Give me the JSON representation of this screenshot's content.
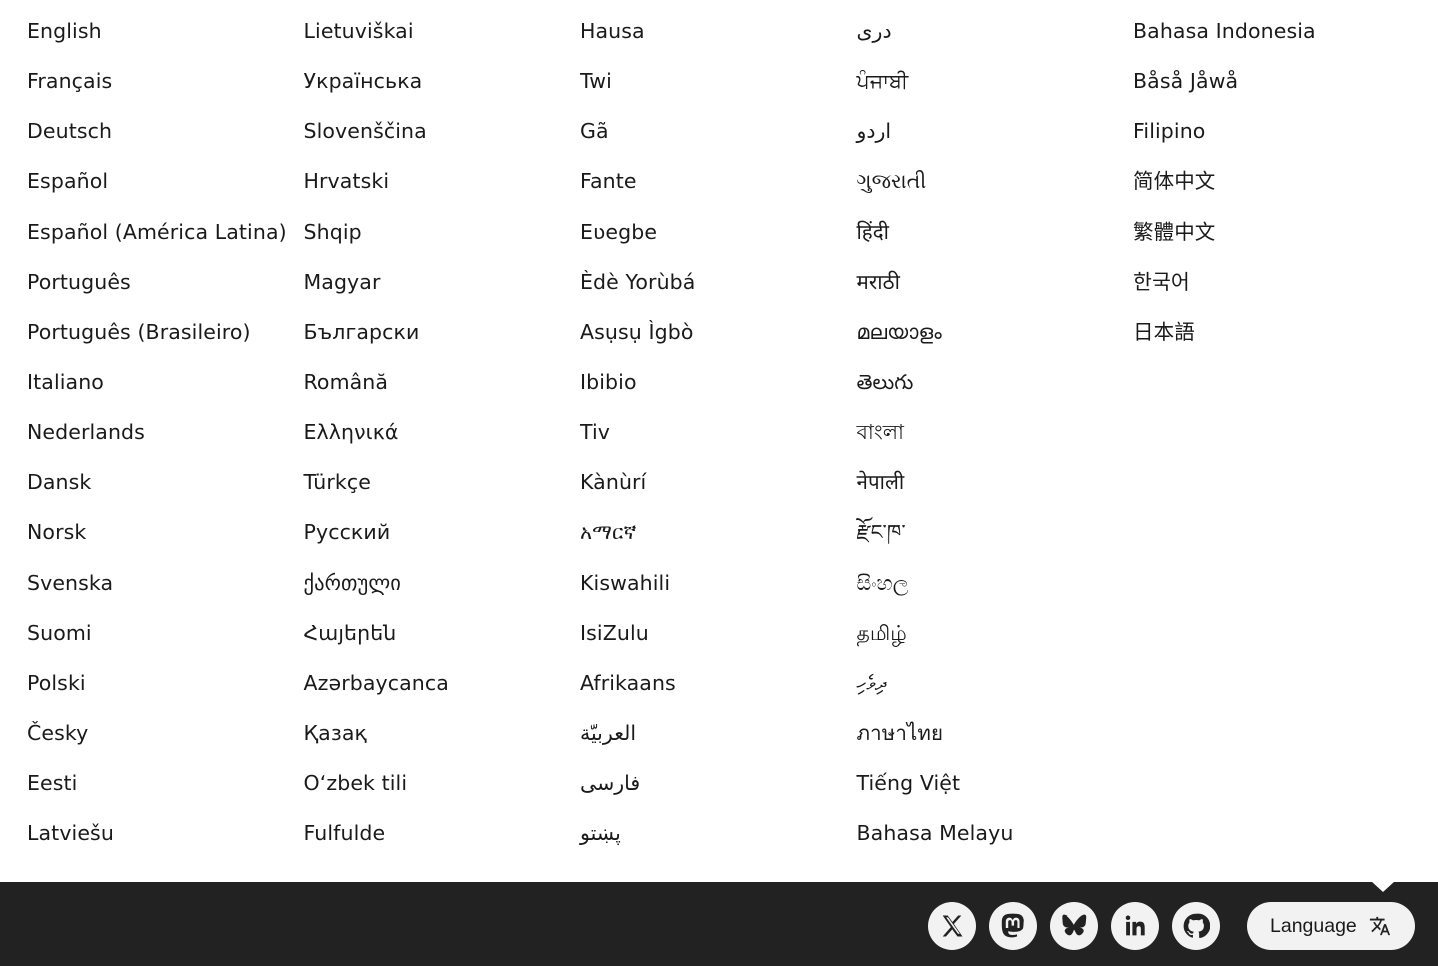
{
  "languages": {
    "columns": [
      [
        "English",
        "Français",
        "Deutsch",
        "Español",
        "Español (América Latina)",
        "Português",
        "Português (Brasileiro)",
        "Italiano",
        "Nederlands",
        "Dansk",
        "Norsk",
        "Svenska",
        "Suomi",
        "Polski",
        "Česky",
        "Eesti",
        "Latviešu"
      ],
      [
        "Lietuviškai",
        "Українська",
        "Slovenščina",
        "Hrvatski",
        "Shqip",
        "Magyar",
        "Български",
        "Română",
        "Ελληνικά",
        "Türkçe",
        "Русский",
        "ქართული",
        "Հայերեն",
        "Azərbaycanca",
        "Қазақ",
        "Oʻzbek tili",
        "Fulfulde"
      ],
      [
        "Hausa",
        "Twi",
        "Gã",
        "Fante",
        "Eʋegbe",
        "Èdè Yorùbá",
        "Asụsụ Ìgbò",
        "Ibibio",
        "Tiv",
        "Kànùrí",
        "አማርኛ",
        "Kiswahili",
        "IsiZulu",
        "Afrikaans",
        "العربيّة",
        "فارسی",
        "پښتو"
      ],
      [
        "دری",
        "ਪੰਜਾਬੀ",
        "اردو",
        "ગુજરાતી",
        "हिंदी",
        "मराठी",
        "മലയാളം",
        "తెలుగు",
        "বাংলা",
        "नेपाली",
        "རྫོང་ཁ་",
        "සිංහල",
        "தமிழ்",
        "ދިވެހި",
        "ภาษาไทย",
        "Tiếng Việt",
        "Bahasa Melayu"
      ],
      [
        "Bahasa Indonesia",
        "Båså Jåwå",
        "Filipino",
        "简体中文",
        "繁體中文",
        "한국어",
        "日本語"
      ]
    ]
  },
  "footer": {
    "social": [
      {
        "icon": "x-icon",
        "name": "x-link"
      },
      {
        "icon": "mastodon-icon",
        "name": "mastodon-link"
      },
      {
        "icon": "bluesky-icon",
        "name": "bluesky-link"
      },
      {
        "icon": "linkedin-icon",
        "name": "linkedin-link"
      },
      {
        "icon": "github-icon",
        "name": "github-link"
      }
    ],
    "language_button": {
      "label": "Language",
      "icon": "translate-icon"
    }
  },
  "colors": {
    "footer_bg": "#222222",
    "button_bg": "#f2f2f2",
    "text": "#1a1a1a"
  }
}
